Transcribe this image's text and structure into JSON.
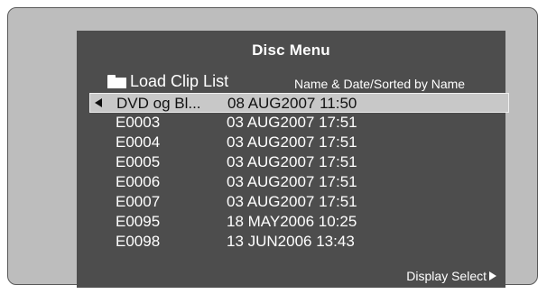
{
  "menu": {
    "title": "Disc Menu",
    "load_clip_list_label": "Load Clip List",
    "folder_icon": "folder-icon",
    "sort_info": "Name & Date/Sorted by Name",
    "display_select_label": "Display Select",
    "selected_clip": {
      "name": "DVD og Bl...",
      "date": "08 AUG2007 11:50"
    },
    "clips": [
      {
        "name": "E0003",
        "date": "03 AUG2007 17:51"
      },
      {
        "name": "E0004",
        "date": "03 AUG2007 17:51"
      },
      {
        "name": "E0005",
        "date": "03 AUG2007 17:51"
      },
      {
        "name": "E0006",
        "date": "03 AUG2007 17:51"
      },
      {
        "name": "E0007",
        "date": "03 AUG2007 17:51"
      },
      {
        "name": "E0095",
        "date": "18 MAY2006 10:25"
      },
      {
        "name": "E0098",
        "date": "13 JUN2006 13:43"
      }
    ],
    "colors": {
      "screen_bg": "#4d4d4d",
      "highlight_bg": "#c8c8c8",
      "text": "#ffffff",
      "bezel": "#bdbdbd"
    }
  }
}
